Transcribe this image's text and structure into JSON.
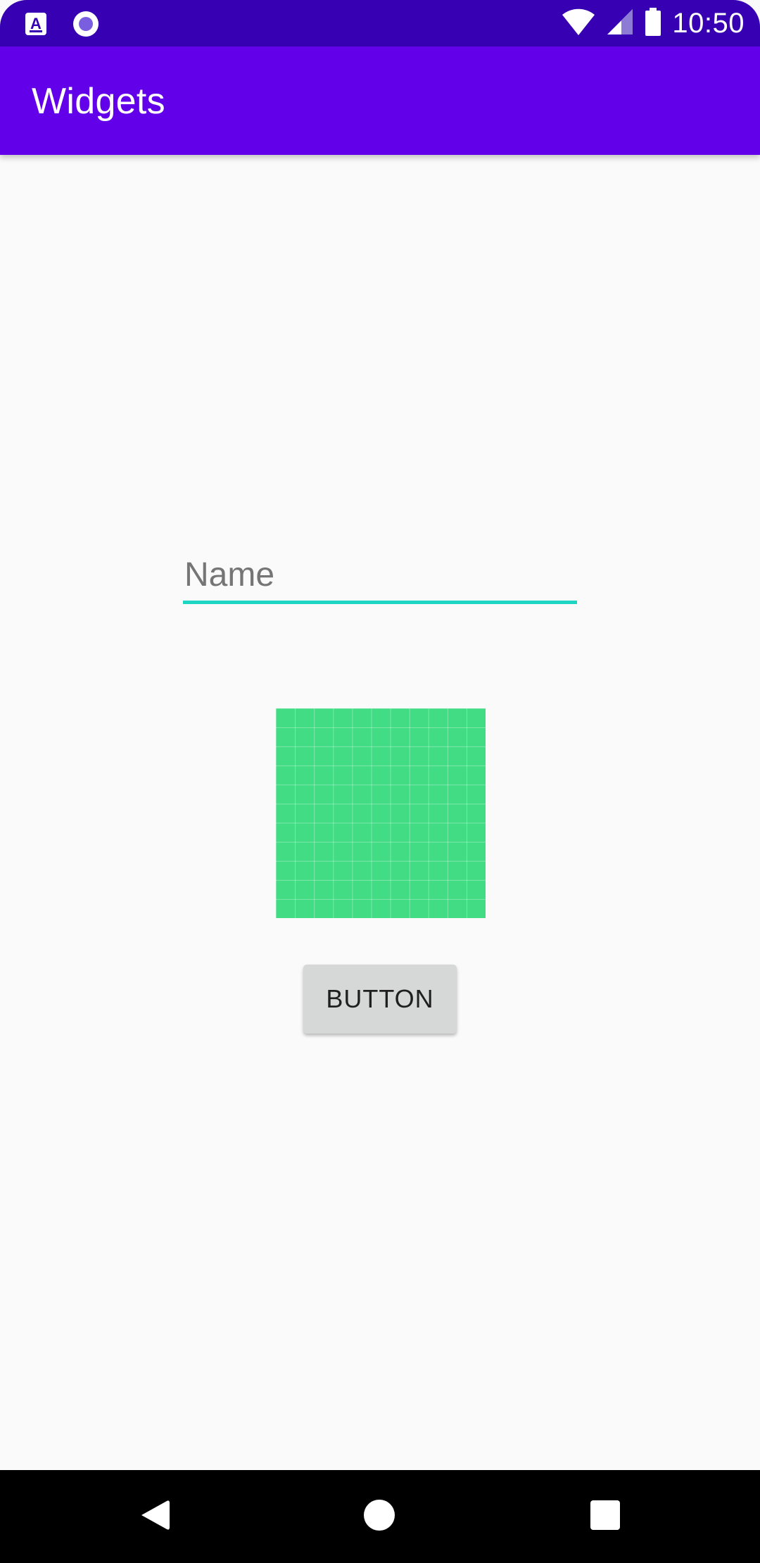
{
  "status_bar": {
    "time": "10:50",
    "left_icons": [
      "accessibility-icon",
      "record-icon"
    ],
    "right_icons": [
      "wifi-icon",
      "signal-icon",
      "battery-icon"
    ]
  },
  "app_bar": {
    "title": "Widgets"
  },
  "main": {
    "name_input": {
      "value": "",
      "placeholder": "Name"
    },
    "image": {
      "icon": "green-grid-image",
      "color": "#42dc84"
    },
    "button_label": "BUTTON"
  },
  "nav_bar": {
    "buttons": [
      "back-icon",
      "home-icon",
      "recents-icon"
    ]
  },
  "colors": {
    "status_bar": "#3700b3",
    "app_bar": "#6200ea",
    "accent": "#1ed4c3",
    "background": "#fafafa"
  }
}
